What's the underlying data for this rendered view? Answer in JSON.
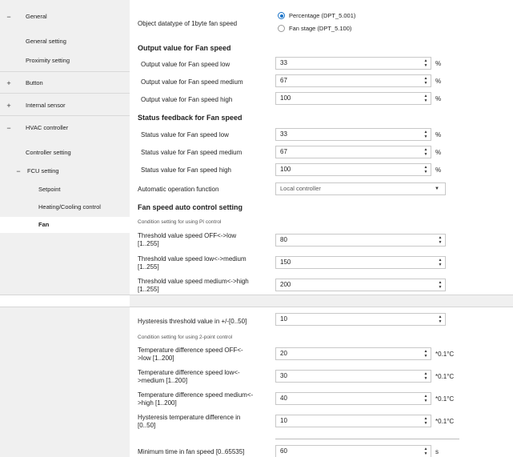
{
  "sidebar": {
    "general": {
      "toggle": "−",
      "label": "General"
    },
    "general_setting": {
      "label": "General setting"
    },
    "proximity_setting": {
      "label": "Proximity setting"
    },
    "button": {
      "toggle": "+",
      "label": "Button"
    },
    "internal_sensor": {
      "toggle": "+",
      "label": "Internal sensor"
    },
    "hvac_controller": {
      "toggle": "−",
      "label": "HVAC controller"
    },
    "controller_setting": {
      "label": "Controller setting"
    },
    "fcu_setting": {
      "toggle": "−",
      "label": "FCU setting"
    },
    "setpoint": {
      "label": "Setpoint"
    },
    "heating_cooling": {
      "label": "Heating/Cooling control"
    },
    "fan": {
      "label": "Fan"
    }
  },
  "main": {
    "datatype": {
      "label": "Object datatype of 1byte fan speed",
      "option1": "Percentage (DPT_5.001)",
      "option2": "Fan stage (DPT_5.100)",
      "selected": "option1"
    },
    "output_section": "Output value for Fan speed",
    "output_low": {
      "label": "Output value for Fan speed low",
      "value": "33",
      "unit": "%"
    },
    "output_medium": {
      "label": "Output value for Fan speed medium",
      "value": "67",
      "unit": "%"
    },
    "output_high": {
      "label": "Output value for Fan speed high",
      "value": "100",
      "unit": "%"
    },
    "status_section": "Status feedback for Fan speed",
    "status_low": {
      "label": "Status value for Fan speed low",
      "value": "33",
      "unit": "%"
    },
    "status_medium": {
      "label": "Status value for Fan speed medium",
      "value": "67",
      "unit": "%"
    },
    "status_high": {
      "label": "Status value for Fan speed high",
      "value": "100",
      "unit": "%"
    },
    "auto_op": {
      "label": "Automatic operation function",
      "value": "Local controller"
    },
    "auto_section": "Fan speed auto control setting",
    "pi_note": "Condition setting for using PI control",
    "thr_off_low": {
      "label1": "Threshold value speed OFF<->low",
      "label2": "[1..255]",
      "value": "80"
    },
    "thr_low_med": {
      "label1": "Threshold value speed low<->medium",
      "label2": "[1..255]",
      "value": "150"
    },
    "thr_med_high": {
      "label1": "Threshold value speed medium<->high",
      "label2": "[1..255]",
      "value": "200"
    },
    "hysteresis": {
      "label": "Hysteresis threshold value in +/-[0..50]",
      "value": "10"
    },
    "twopoint_note": "Condition setting for using 2-point control",
    "td_off_low": {
      "label1": "Temperature difference speed OFF<-",
      "label2": ">low [1..200]",
      "value": "20",
      "unit": "*0.1°C"
    },
    "td_low_med": {
      "label1": "Temperature difference speed low<-",
      "label2": ">medium [1..200]",
      "value": "30",
      "unit": "*0.1°C"
    },
    "td_med_high": {
      "label1": "Temperature difference speed medium<-",
      "label2": ">high [1..200]",
      "value": "40",
      "unit": "*0.1°C"
    },
    "hyst_temp": {
      "label1": "Hysteresis temperature difference in",
      "label2": "[0..50]",
      "value": "10",
      "unit": "*0.1°C"
    },
    "min_time": {
      "label": "Minimum time in fan speed [0..65535]",
      "value": "60",
      "unit": "s"
    }
  },
  "icons": {
    "spin_up": "▲",
    "spin_down": "▼",
    "caret": "▼"
  },
  "colors": {
    "sidebar_bg": "#f0f0f0",
    "radio_accent": "#1a73c8"
  }
}
